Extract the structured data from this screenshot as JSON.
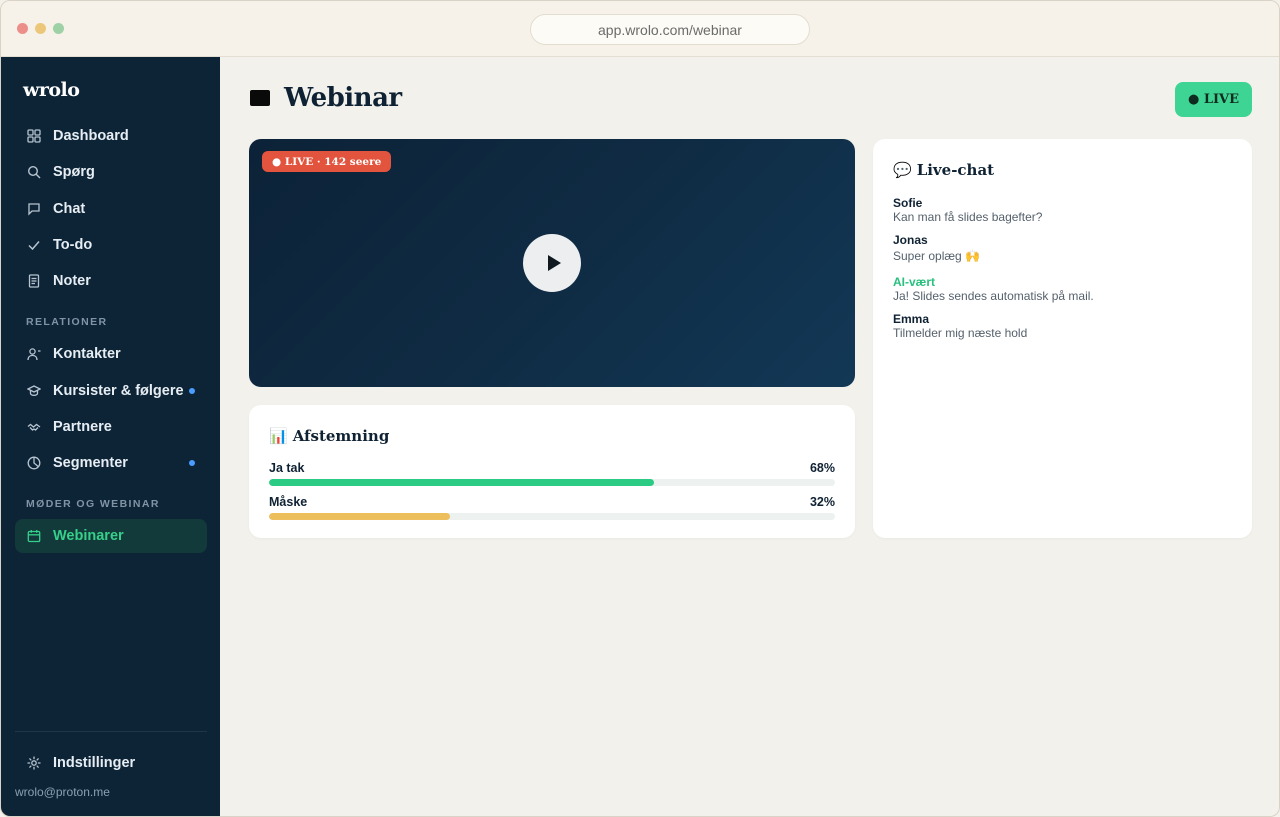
{
  "browser": {
    "url": "app.wrolo.com/webinar"
  },
  "sidebar": {
    "logo": "wrolo",
    "items": [
      {
        "label": "Dashboard",
        "icon": "grid-icon"
      },
      {
        "label": "Spørg",
        "icon": "search-icon"
      },
      {
        "label": "Chat",
        "icon": "chat-icon"
      },
      {
        "label": "To-do",
        "icon": "check-icon"
      },
      {
        "label": "Noter",
        "icon": "note-icon"
      }
    ],
    "section_relations": "RELATIONER",
    "relations": [
      {
        "label": "Kontakter",
        "icon": "user-icon",
        "dot": false
      },
      {
        "label": "Kursister & følgere",
        "icon": "graduation-cap-icon",
        "dot": true
      },
      {
        "label": "Partnere",
        "icon": "handshake-icon",
        "dot": false
      },
      {
        "label": "Segmenter",
        "icon": "pie-chart-icon",
        "dot": true
      }
    ],
    "section_meetings": "MØDER OG WEBINAR",
    "meetings": [
      {
        "label": "Webinarer",
        "icon": "calendar-icon",
        "active": true
      }
    ],
    "settings_label": "Indstillinger",
    "user_email": "wrolo@proton.me"
  },
  "header": {
    "title": "Webinar",
    "live_button": "● LIVE"
  },
  "video": {
    "badge": "● LIVE · 142 seere"
  },
  "poll": {
    "title": "Afstemning",
    "icon": "📊",
    "options": [
      {
        "label": "Ja tak",
        "percent_text": "68%",
        "value": 0.68,
        "color": "#2bcb84"
      },
      {
        "label": "Måske",
        "percent_text": "32%",
        "value": 0.32,
        "color": "#edbf5c"
      }
    ]
  },
  "chat": {
    "title": "Live-chat",
    "icon": "💬",
    "messages": [
      {
        "author": "Sofie",
        "text": "Kan man få slides bagefter?",
        "ai": false
      },
      {
        "author": "Jonas",
        "text": "Super oplæg 🙌",
        "ai": false
      },
      {
        "author": "AI-vært",
        "text": "Ja! Slides sendes automatisk på mail.",
        "ai": true
      },
      {
        "author": "Emma",
        "text": "Tilmelder mig næste hold",
        "ai": false
      }
    ]
  },
  "colors": {
    "sidebar_bg": "#0d2437",
    "accent_green": "#36d08a",
    "live_red": "#e2543e"
  }
}
